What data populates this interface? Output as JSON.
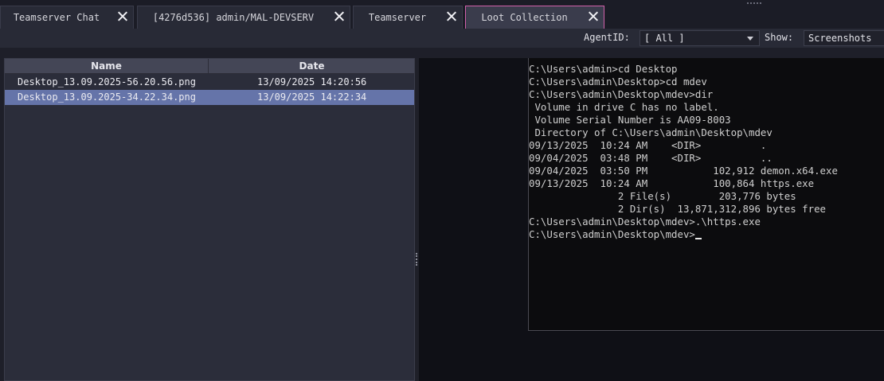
{
  "tabs": [
    {
      "label": "Teamserver Chat"
    },
    {
      "label": "[4276d536] admin/MAL-DEVSERV"
    },
    {
      "label": "Teamserver"
    },
    {
      "label": "Loot Collection"
    }
  ],
  "toolbar": {
    "agent_label": "AgentID:",
    "agent_value": "[ All ]",
    "show_label": "Show:",
    "show_value": "Screenshots"
  },
  "loot_table": {
    "columns": [
      "Name",
      "Date"
    ],
    "rows": [
      {
        "name": "Desktop_13.09.2025-56.20.56.png",
        "date": "13/09/2025 14:20:56"
      },
      {
        "name": "Desktop_13.09.2025-34.22.34.png",
        "date": "13/09/2025 14:22:34"
      }
    ],
    "selected_row": 1
  },
  "screenshot_console": {
    "lines": [
      "C:\\Users\\admin>cd Desktop",
      "",
      "C:\\Users\\admin\\Desktop>cd mdev",
      "",
      "C:\\Users\\admin\\Desktop\\mdev>dir",
      " Volume in drive C has no label.",
      " Volume Serial Number is AA09-8003",
      "",
      " Directory of C:\\Users\\admin\\Desktop\\mdev",
      "",
      "09/13/2025  10:24 AM    <DIR>          .",
      "09/04/2025  03:48 PM    <DIR>          ..",
      "09/04/2025  03:50 PM           102,912 demon.x64.exe",
      "09/13/2025  10:24 AM           100,864 https.exe",
      "               2 File(s)        203,776 bytes",
      "               2 Dir(s)  13,871,312,896 bytes free",
      "",
      "C:\\Users\\admin\\Desktop\\mdev>.\\https.exe",
      ""
    ],
    "prompt": "C:\\Users\\admin\\Desktop\\mdev>"
  },
  "colors": {
    "active_tab_border": "#d05fa9",
    "selected_row": "#6574a9",
    "background": "#1e1f29"
  }
}
